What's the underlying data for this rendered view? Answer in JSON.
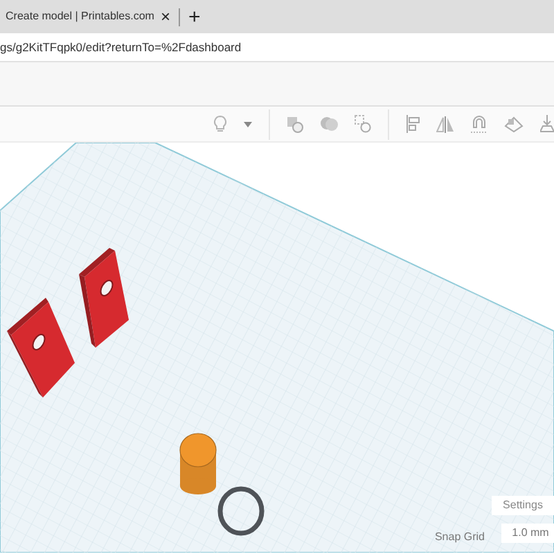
{
  "browser_tab": {
    "title": "Create model | Printables.com",
    "close": "×",
    "new_tab": "+"
  },
  "address_bar": {
    "url": "gs/g2KitTFqpk0/edit?returnTo=%2Fdashboard"
  },
  "scene_objects": [
    {
      "kind": "bracket",
      "color": "#d62a2f"
    },
    {
      "kind": "bracket",
      "color": "#d62a2f"
    },
    {
      "kind": "cylinder",
      "color": "#f0962c"
    },
    {
      "kind": "ring",
      "color": "#4f5358"
    }
  ],
  "settings_button": "Settings",
  "snap_grid": {
    "label": "Snap Grid",
    "value": "1.0 mm"
  }
}
